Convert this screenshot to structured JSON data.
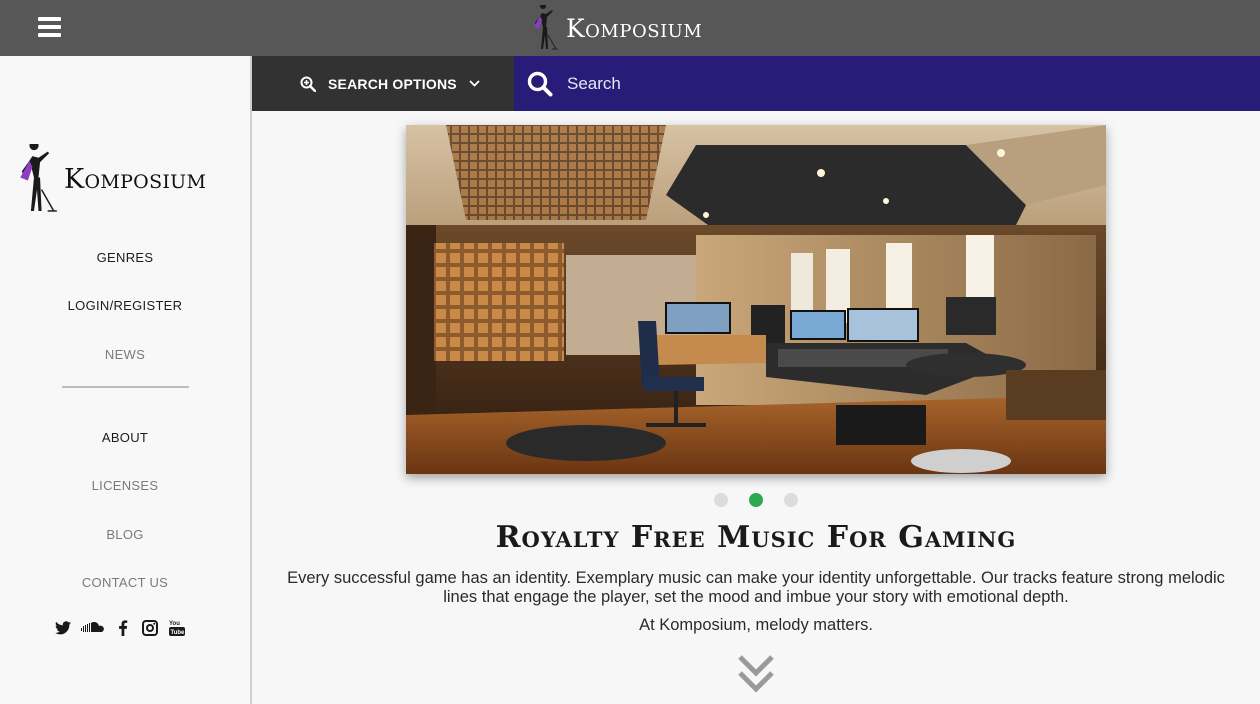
{
  "header": {
    "brand": "Komposium",
    "menu_icon": "hamburger-menu-icon"
  },
  "sidebar": {
    "brand": "Komposium",
    "nav_primary": [
      {
        "label": "GENRES",
        "active": true
      },
      {
        "label": "LOGIN/REGISTER",
        "active": true
      },
      {
        "label": "NEWS",
        "active": false
      }
    ],
    "nav_secondary": [
      {
        "label": "ABOUT",
        "active": true
      },
      {
        "label": "LICENSES",
        "active": false
      },
      {
        "label": "BLOG",
        "active": false
      },
      {
        "label": "CONTACT US",
        "active": false
      }
    ],
    "social_icons": [
      "twitter-icon",
      "soundcloud-icon",
      "facebook-icon",
      "instagram-icon",
      "youtube-icon"
    ]
  },
  "search": {
    "options_label": "SEARCH OPTIONS",
    "placeholder": "Search"
  },
  "carousel": {
    "image_alt": "Music production studio with monitors, mixing desk and drum kit",
    "slide_count": 3,
    "active_slide": 2
  },
  "main": {
    "headline": "Royalty Free Music For Gaming",
    "description": "Every successful game has an identity. Exemplary music can make your identity unforgettable. Our tracks feature strong melodic lines that engage the player, set the mood and imbue your story with emotional depth.",
    "tagline": "At Komposium, melody matters."
  },
  "colors": {
    "topbar": "#575757",
    "search_options_bg": "#323232",
    "search_bar_bg": "#281c78",
    "active_dot": "#2fa84f",
    "logo_purple": "#8a3fc0"
  }
}
